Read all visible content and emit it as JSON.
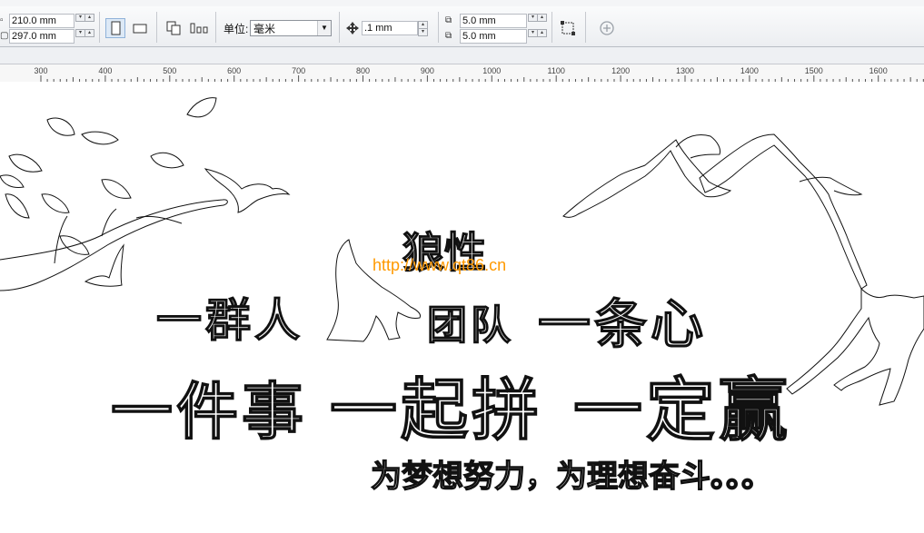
{
  "property_bar": {
    "page_width": "210.0 mm",
    "page_height": "297.0 mm",
    "units_label": "单位:",
    "units_value": "毫米",
    "nudge_value": ".1 mm",
    "duplicate_x": "5.0 mm",
    "duplicate_y": "5.0 mm"
  },
  "ruler": {
    "ticks": [
      "300",
      "400",
      "500",
      "600",
      "700",
      "800",
      "900",
      "1000",
      "1100",
      "1200",
      "1300",
      "1400",
      "1500",
      "1600"
    ]
  },
  "artwork": {
    "heading": "狼性",
    "line1_left": "一群人",
    "line1_mid": "团队",
    "line1_right": "一条心",
    "line2_a": "一件事",
    "line2_b": "一起拼",
    "line2_c": "一定赢",
    "slogan": "为梦想努力，为理想奋斗。。。",
    "watermark": "http://www.qt86.cn"
  },
  "icons": [
    "portrait-icon",
    "landscape-icon",
    "all-pages-icon",
    "current-page-icon",
    "nudge-icon",
    "duplicate-x-icon",
    "duplicate-y-icon",
    "treat-as-filled-icon",
    "add-preset-icon"
  ]
}
